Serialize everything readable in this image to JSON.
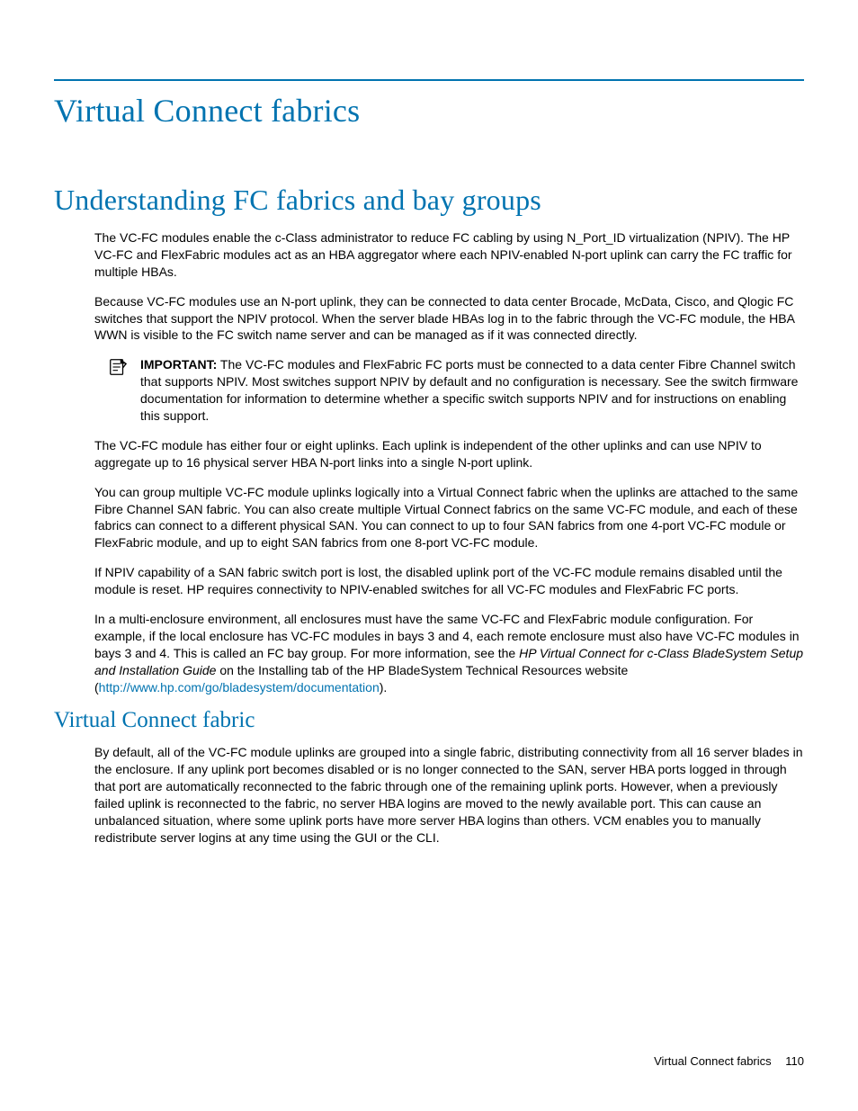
{
  "page": {
    "title": "Virtual Connect fabrics",
    "section1": {
      "heading": "Understanding FC fabrics and bay groups",
      "p1": "The VC-FC modules enable the c-Class administrator to reduce FC cabling by using N_Port_ID virtualization (NPIV). The HP VC-FC and FlexFabric modules act as an HBA aggregator where each NPIV-enabled N-port uplink can carry the FC traffic for multiple HBAs.",
      "p2": "Because VC-FC modules use an N-port uplink, they can be connected to data center Brocade, McData, Cisco, and Qlogic FC switches that support the NPIV protocol. When the server blade HBAs log in to the fabric through the VC-FC module, the HBA WWN is visible to the FC switch name server and can be managed as if it was connected directly.",
      "important_label": "IMPORTANT:",
      "important_text": " The VC-FC modules and FlexFabric FC ports must be connected to a data center Fibre Channel switch that supports NPIV. Most switches support NPIV by default and no configuration is necessary. See the switch firmware documentation for information to determine whether a specific switch supports NPIV and for instructions on enabling this support.",
      "p3": "The VC-FC module has either four or eight uplinks. Each uplink is independent of the other uplinks and can use NPIV to aggregate up to 16 physical server HBA N-port links into a single N-port uplink.",
      "p4": "You can group multiple VC-FC module uplinks logically into a Virtual Connect fabric when the uplinks are attached to the same Fibre Channel SAN fabric. You can also create multiple Virtual Connect fabrics on the same VC-FC module, and each of these fabrics can connect to a different physical SAN. You can connect to up to four SAN fabrics from one 4-port VC-FC module or FlexFabric module, and up to eight SAN fabrics from one 8-port VC-FC module.",
      "p5": "If NPIV capability of a SAN fabric switch port is lost, the disabled uplink port of the VC-FC module remains disabled until the module is reset. HP requires connectivity to NPIV-enabled switches for all VC-FC modules and FlexFabric FC ports.",
      "p6a": "In a multi-enclosure environment, all enclosures must have the same VC-FC and FlexFabric module configuration. For example, if the local enclosure has VC-FC modules in bays 3 and 4, each remote enclosure must also have VC-FC modules in bays 3 and 4. This is called an FC bay group. For more information, see the ",
      "p6_italic": "HP Virtual Connect for c-Class BladeSystem Setup and Installation Guide",
      "p6b": " on the Installing tab of the HP BladeSystem Technical Resources website (",
      "p6_link": "http://www.hp.com/go/bladesystem/documentation",
      "p6c": ")."
    },
    "section2": {
      "heading": "Virtual Connect fabric",
      "p1": "By default, all of the VC-FC module uplinks are grouped into a single fabric, distributing connectivity from all 16 server blades in the enclosure. If any uplink port becomes disabled or is no longer connected to the SAN, server HBA ports logged in through that port are automatically reconnected to the fabric through one of the remaining uplink ports. However, when a previously failed uplink is reconnected to the fabric, no server HBA logins are moved to the newly available port. This can cause an unbalanced situation, where some uplink ports have more server HBA logins than others. VCM enables you to manually redistribute server logins at any time using the GUI or the CLI."
    },
    "footer": {
      "title": "Virtual Connect fabrics",
      "page_number": "110"
    }
  }
}
